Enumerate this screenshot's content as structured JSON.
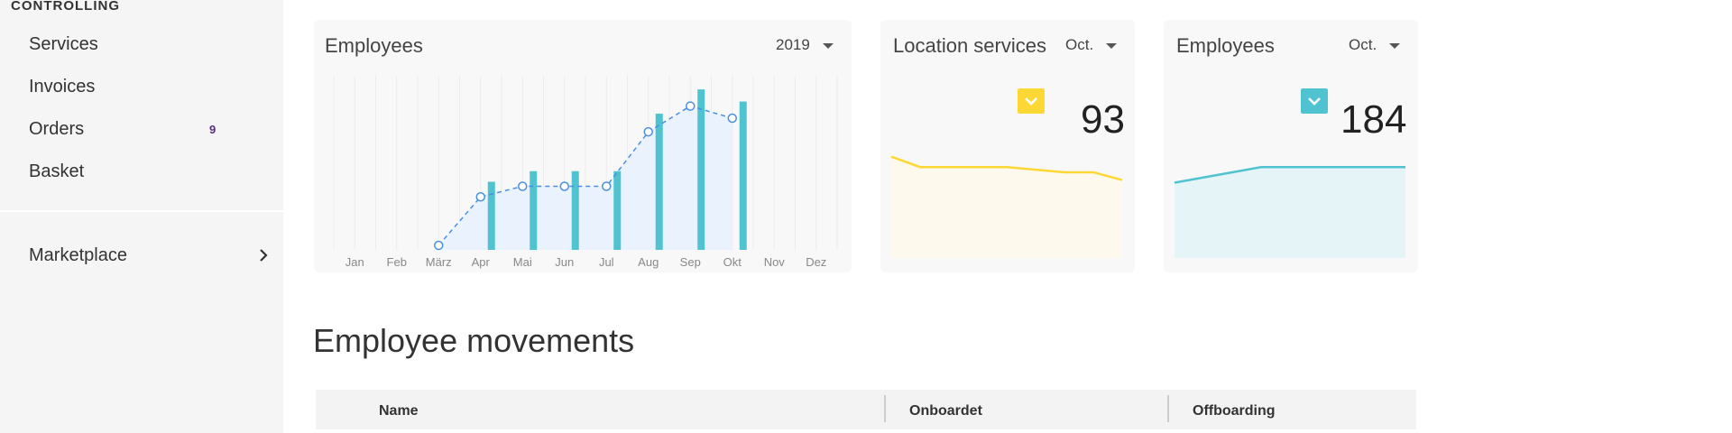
{
  "sidebar": {
    "section_title": "CONTROLLING",
    "items": [
      {
        "label": "Services"
      },
      {
        "label": "Invoices"
      },
      {
        "label": "Orders",
        "badge": "9"
      },
      {
        "label": "Basket"
      }
    ],
    "marketplace": {
      "label": "Marketplace"
    }
  },
  "cards": {
    "employees_year": {
      "title": "Employees",
      "selected_period": "2019"
    },
    "location_services": {
      "title": "Location services",
      "selected_period": "Oct.",
      "value": "93",
      "accent": "#fdd835"
    },
    "employees_month": {
      "title": "Employees",
      "selected_period": "Oct.",
      "value": "184",
      "accent": "#4fc3d0"
    }
  },
  "chart_data": [
    {
      "type": "bar",
      "categories": [
        "Jan",
        "Feb",
        "März",
        "Apr",
        "Mai",
        "Jun",
        "Jul",
        "Aug",
        "Sep",
        "Okt",
        "Nov",
        "Dez"
      ],
      "series": [
        {
          "values": [
            0,
            0,
            0,
            48,
            55,
            55,
            55,
            94,
            110,
            102,
            0,
            0
          ]
        },
        {
          "values": [
            0,
            0,
            0,
            0,
            0,
            0,
            0,
            0,
            0,
            0,
            0,
            0
          ],
          "comment_unused": ""
        }
      ],
      "bar_values": [
        0,
        0,
        0,
        45,
        52,
        52,
        52,
        90,
        106,
        98,
        0,
        0
      ],
      "line_values": [
        null,
        null,
        3,
        35,
        42,
        42,
        42,
        78,
        95,
        87,
        null,
        null
      ],
      "colors": {
        "bar": "#4fc3d0",
        "line": "#4a90e2",
        "area": "#eaf2fd"
      },
      "grid": true
    },
    {
      "type": "line",
      "x": [
        "1",
        "2",
        "3",
        "4",
        "5",
        "6",
        "7",
        "8",
        "9"
      ],
      "values": [
        78,
        70,
        70,
        70,
        70,
        68,
        66,
        66,
        60
      ],
      "ylim": [
        0,
        100
      ],
      "colors": {
        "line": "#fdd835",
        "area": "#fdf9ec"
      }
    },
    {
      "type": "line",
      "x": [
        "1",
        "2",
        "3",
        "4",
        "5",
        "6",
        "7",
        "8",
        "9"
      ],
      "values": [
        58,
        62,
        66,
        70,
        70,
        70,
        70,
        70,
        70
      ],
      "ylim": [
        0,
        100
      ],
      "colors": {
        "line": "#4fc3d0",
        "area": "#e5f4f6"
      }
    }
  ],
  "section": {
    "heading": "Employee movements"
  },
  "table": {
    "columns": [
      "Name",
      "Onboardet",
      "Offboarding"
    ]
  }
}
